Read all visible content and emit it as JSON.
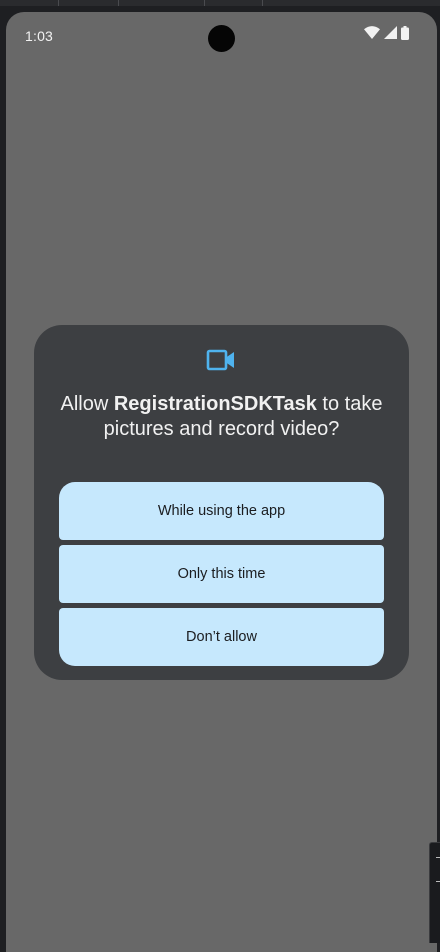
{
  "status_bar": {
    "time": "1:03",
    "icons": [
      "wifi-icon",
      "cellular-signal-icon",
      "battery-icon"
    ]
  },
  "permission_dialog": {
    "icon": "video-camera-icon",
    "title_prefix": "Allow ",
    "app_name": "RegistrationSDKTask",
    "title_suffix": " to take pictures and record video?",
    "options": [
      {
        "label": "While using the app"
      },
      {
        "label": "Only this time"
      },
      {
        "label": "Don’t allow"
      }
    ]
  },
  "colors": {
    "scrim": "#686868",
    "dialog_background": "#3d3f42",
    "button_background": "#c6e8fd",
    "accent_icon": "#4fb3ee",
    "title_text": "#f1f1f1"
  }
}
